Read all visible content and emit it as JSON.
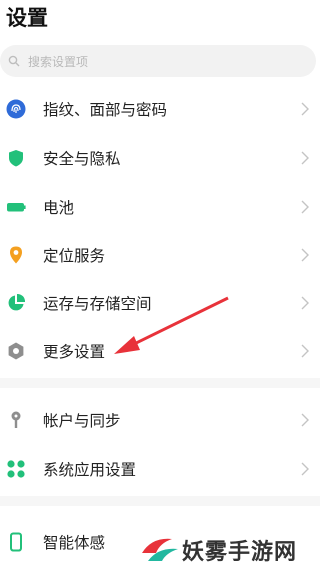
{
  "page": {
    "title": "设置"
  },
  "search": {
    "placeholder": "搜索设置项"
  },
  "items": [
    {
      "label": "指纹、面部与密码",
      "icon": "fingerprint-icon"
    },
    {
      "label": "安全与隐私",
      "icon": "shield-icon"
    },
    {
      "label": "电池",
      "icon": "battery-icon"
    },
    {
      "label": "定位服务",
      "icon": "location-pin-icon"
    },
    {
      "label": "运存与存储空间",
      "icon": "pie-chart-icon"
    },
    {
      "label": "更多设置",
      "icon": "gear-icon"
    },
    {
      "label": "帐户与同步",
      "icon": "key-icon"
    },
    {
      "label": "系统应用设置",
      "icon": "apps-grid-icon"
    },
    {
      "label": "智能体感",
      "icon": "phone-outline-icon"
    }
  ],
  "watermark": {
    "text": "妖雾手游网"
  },
  "colors": {
    "fingerprint": "#2f6bd8",
    "shield": "#22c07a",
    "battery": "#22c07a",
    "location": "#f4a020",
    "pie": "#22c07a",
    "gear": "#8e8e8e",
    "key": "#8e8e8e",
    "apps": "#22c07a",
    "phone": "#22c07a",
    "arrow": "#e8323a"
  }
}
